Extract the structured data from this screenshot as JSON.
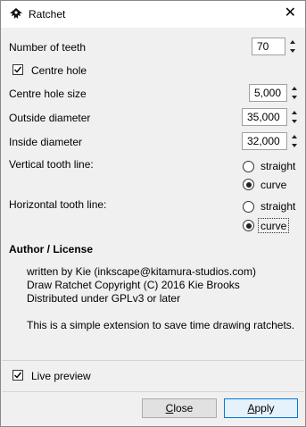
{
  "window": {
    "title": "Ratchet",
    "close_glyph": "✕"
  },
  "fields": {
    "teeth": {
      "label": "Number of teeth",
      "value": "70"
    },
    "centre_hole": {
      "label": "Centre hole",
      "checked": true
    },
    "centre_hole_size": {
      "label": "Centre hole size",
      "value": "5,000"
    },
    "outside_diameter": {
      "label": "Outside diameter",
      "value": "35,000"
    },
    "inside_diameter": {
      "label": "Inside diameter",
      "value": "32,000"
    }
  },
  "vertical_tooth_line": {
    "label": "Vertical tooth line:",
    "options": [
      "straight",
      "curve"
    ],
    "selected": "curve"
  },
  "horizontal_tooth_line": {
    "label": "Horizontal tooth line:",
    "options": [
      "straight",
      "curve"
    ],
    "selected": "curve"
  },
  "about": {
    "heading": "Author / License",
    "lines": [
      "written by Kie (inkscape@kitamura-studios.com)",
      "Draw Ratchet Copyright (C) 2016 Kie Brooks",
      "Distributed under GPLv3 or later"
    ],
    "description": "This is a simple extension to save time drawing ratchets."
  },
  "live_preview": {
    "label": "Live preview",
    "checked": true
  },
  "buttons": {
    "close": {
      "mnemonic": "C",
      "rest": "lose"
    },
    "apply": {
      "mnemonic": "A",
      "rest": "pply"
    }
  },
  "colors": {
    "default_button_border": "#0078d7",
    "default_button_bg": "#e5f1fb"
  }
}
